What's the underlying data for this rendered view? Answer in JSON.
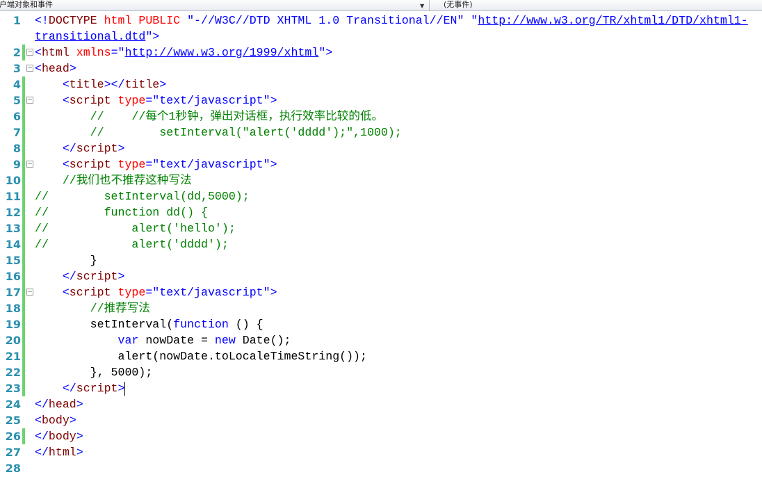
{
  "header": {
    "object_dropdown": "客户端对象和事件",
    "event_dropdown": "(无事件)"
  },
  "colors": {
    "tag": "#800000",
    "attr": "#ff0000",
    "value": "#0000ff",
    "comment": "#008000",
    "line_number": "#2b91af",
    "changed_bar": "#6cd36c"
  },
  "lines": [
    {
      "n": "1",
      "chg": false,
      "fold": false,
      "t": [
        [
          "<!",
          "br"
        ],
        [
          "DOCTYPE",
          "tag"
        ],
        [
          " html PUBLIC ",
          "attr"
        ],
        [
          "\"-//W3C//DTD XHTML 1.0 Transitional//EN\"",
          "val"
        ],
        [
          " ",
          "pl"
        ],
        [
          "\"",
          "val"
        ],
        [
          "http://www.w3.org/TR/xhtml1/DTD/xhtml1-",
          "url"
        ]
      ]
    },
    {
      "n": "",
      "chg": false,
      "fold": false,
      "t": [
        [
          "transitional.dtd",
          "url"
        ],
        [
          "\">",
          "val"
        ]
      ]
    },
    {
      "n": "2",
      "chg": true,
      "fold": true,
      "t": [
        [
          "<",
          "br"
        ],
        [
          "html",
          "tag"
        ],
        [
          " xmlns",
          "attr"
        ],
        [
          "=\"",
          "val"
        ],
        [
          "http://www.w3.org/1999/xhtml",
          "url"
        ],
        [
          "\">",
          "val"
        ]
      ]
    },
    {
      "n": "3",
      "chg": false,
      "fold": true,
      "t": [
        [
          "<",
          "br"
        ],
        [
          "head",
          "tag"
        ],
        [
          ">",
          "br"
        ]
      ]
    },
    {
      "n": "4",
      "chg": true,
      "fold": false,
      "t": [
        [
          "    <",
          "br"
        ],
        [
          "title",
          "tag"
        ],
        [
          "></",
          "br"
        ],
        [
          "title",
          "tag"
        ],
        [
          ">",
          "br"
        ]
      ]
    },
    {
      "n": "5",
      "chg": true,
      "fold": true,
      "t": [
        [
          "    <",
          "br"
        ],
        [
          "script",
          "tag"
        ],
        [
          " type",
          "attr"
        ],
        [
          "=\"text/javascript\">",
          "val"
        ]
      ]
    },
    {
      "n": "6",
      "chg": true,
      "fold": false,
      "t": [
        [
          "        //    //每个1秒钟，弹出对话框，执行效率比较的低。",
          "com"
        ]
      ]
    },
    {
      "n": "7",
      "chg": true,
      "fold": false,
      "t": [
        [
          "        //        setInterval(\"alert('dddd');\",1000);",
          "com"
        ]
      ]
    },
    {
      "n": "8",
      "chg": true,
      "fold": false,
      "t": [
        [
          "    </",
          "br"
        ],
        [
          "script",
          "tag"
        ],
        [
          ">",
          "br"
        ]
      ]
    },
    {
      "n": "9",
      "chg": true,
      "fold": true,
      "t": [
        [
          "    <",
          "br"
        ],
        [
          "script",
          "tag"
        ],
        [
          " type",
          "attr"
        ],
        [
          "=\"text/javascript\">",
          "val"
        ]
      ]
    },
    {
      "n": "10",
      "chg": true,
      "fold": false,
      "t": [
        [
          "    //我们也不推荐这种写法",
          "com"
        ]
      ]
    },
    {
      "n": "11",
      "chg": true,
      "fold": false,
      "t": [
        [
          "//        setInterval(dd,5000);",
          "com"
        ]
      ]
    },
    {
      "n": "12",
      "chg": true,
      "fold": false,
      "t": [
        [
          "//        function dd() {",
          "com"
        ]
      ]
    },
    {
      "n": "13",
      "chg": true,
      "fold": false,
      "t": [
        [
          "//            alert('hello');",
          "com"
        ]
      ]
    },
    {
      "n": "14",
      "chg": true,
      "fold": false,
      "t": [
        [
          "//            alert('dddd');",
          "com"
        ]
      ]
    },
    {
      "n": "15",
      "chg": true,
      "fold": false,
      "t": [
        [
          "        }",
          "pl"
        ]
      ]
    },
    {
      "n": "16",
      "chg": true,
      "fold": false,
      "t": [
        [
          "    </",
          "br"
        ],
        [
          "script",
          "tag"
        ],
        [
          ">",
          "br"
        ]
      ]
    },
    {
      "n": "17",
      "chg": true,
      "fold": true,
      "t": [
        [
          "    <",
          "br"
        ],
        [
          "script",
          "tag"
        ],
        [
          " type",
          "attr"
        ],
        [
          "=\"text/javascript\">",
          "val"
        ]
      ]
    },
    {
      "n": "18",
      "chg": true,
      "fold": false,
      "t": [
        [
          "        //推荐写法",
          "com"
        ]
      ]
    },
    {
      "n": "19",
      "chg": true,
      "fold": false,
      "t": [
        [
          "        setInterval(",
          "pl"
        ],
        [
          "function",
          "kw"
        ],
        [
          " () {",
          "pl"
        ]
      ]
    },
    {
      "n": "20",
      "chg": true,
      "fold": false,
      "t": [
        [
          "            ",
          "pl"
        ],
        [
          "var",
          "kw"
        ],
        [
          " nowDate = ",
          "pl"
        ],
        [
          "new",
          "kw"
        ],
        [
          " Date();",
          "pl"
        ]
      ]
    },
    {
      "n": "21",
      "chg": true,
      "fold": false,
      "t": [
        [
          "            alert(nowDate.toLocaleTimeString());",
          "pl"
        ]
      ]
    },
    {
      "n": "22",
      "chg": true,
      "fold": false,
      "t": [
        [
          "        }, 5000);",
          "pl"
        ]
      ]
    },
    {
      "n": "23",
      "chg": true,
      "fold": false,
      "caret": true,
      "t": [
        [
          "    </",
          "br"
        ],
        [
          "script",
          "tag"
        ],
        [
          ">",
          "br"
        ]
      ]
    },
    {
      "n": "24",
      "chg": false,
      "fold": false,
      "t": [
        [
          "</",
          "br"
        ],
        [
          "head",
          "tag"
        ],
        [
          ">",
          "br"
        ]
      ]
    },
    {
      "n": "25",
      "chg": false,
      "fold": false,
      "t": [
        [
          "<",
          "br"
        ],
        [
          "body",
          "tag"
        ],
        [
          ">",
          "br"
        ]
      ]
    },
    {
      "n": "26",
      "chg": true,
      "fold": false,
      "t": [
        [
          "</",
          "br"
        ],
        [
          "body",
          "tag"
        ],
        [
          ">",
          "br"
        ]
      ]
    },
    {
      "n": "27",
      "chg": false,
      "fold": false,
      "t": [
        [
          "</",
          "br"
        ],
        [
          "html",
          "tag"
        ],
        [
          ">",
          "br"
        ]
      ]
    },
    {
      "n": "28",
      "chg": false,
      "fold": false,
      "t": []
    }
  ]
}
